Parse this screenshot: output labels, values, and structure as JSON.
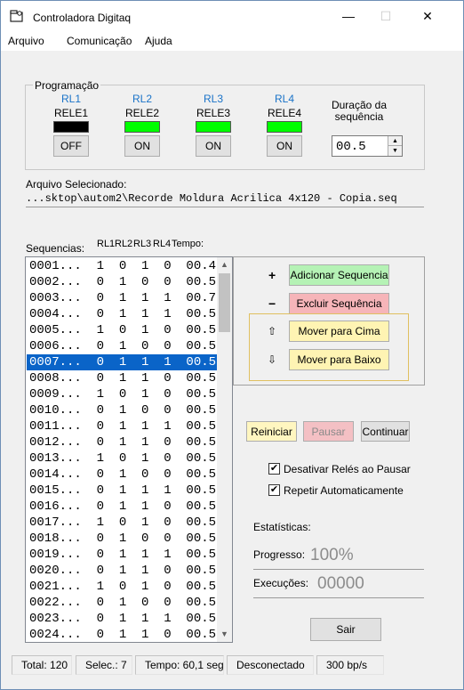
{
  "window": {
    "title": "Controladora Digitaq",
    "minimize": "—",
    "maximize": "☐",
    "close": "✕"
  },
  "menu": {
    "items": [
      "Arquivo",
      "Comunicação",
      "Ajuda"
    ]
  },
  "programacao": {
    "title": "Programação",
    "relays": [
      {
        "rl": "RL1",
        "name": "RELE1",
        "state": "off",
        "color": "#000000",
        "button": "OFF"
      },
      {
        "rl": "RL2",
        "name": "RELE2",
        "state": "on",
        "color": "#00ff00",
        "button": "ON"
      },
      {
        "rl": "RL3",
        "name": "RELE3",
        "state": "on",
        "color": "#00ff00",
        "button": "ON"
      },
      {
        "rl": "RL4",
        "name": "RELE4",
        "state": "on",
        "color": "#00ff00",
        "button": "ON"
      }
    ],
    "duracao_label_1": "Duração da",
    "duracao_label_2": "sequência",
    "duracao_value": "00.5"
  },
  "arquivo": {
    "label": "Arquivo Selecionado:",
    "path": "...sktop\\autom2\\Recorde Moldura Acrilica 4x120 - Copia.seq"
  },
  "sequencias": {
    "label": "Sequencias:",
    "headers": [
      "RL1",
      "RL2",
      "RL3",
      "RL4",
      "Tempo:"
    ],
    "selected_index": 6,
    "rows": [
      "0001...  1  0  1  0  00.4",
      "0002...  0  1  0  0  00.5",
      "0003...  0  1  1  1  00.7",
      "0004...  0  1  1  1  00.5",
      "0005...  1  0  1  0  00.5",
      "0006...  0  1  0  0  00.5",
      "0007...  0  1  1  1  00.5",
      "0008...  0  1  1  0  00.5",
      "0009...  1  0  1  0  00.5",
      "0010...  0  1  0  0  00.5",
      "0011...  0  1  1  1  00.5",
      "0012...  0  1  1  0  00.5",
      "0013...  1  0  1  0  00.5",
      "0014...  0  1  0  0  00.5",
      "0015...  0  1  1  1  00.5",
      "0016...  0  1  1  0  00.5",
      "0017...  1  0  1  0  00.5",
      "0018...  0  1  0  0  00.5",
      "0019...  0  1  1  1  00.5",
      "0020...  0  1  1  0  00.5",
      "0021...  1  0  1  0  00.5",
      "0022...  0  1  0  0  00.5",
      "0023...  0  1  1  1  00.5",
      "0024...  0  1  1  0  00.5"
    ]
  },
  "actions": {
    "adicionar": "Adicionar Sequencia",
    "excluir": "Excluir Sequência",
    "mover_cima": "Mover para Cima",
    "mover_baixo": "Mover para Baixo",
    "plus_sign": "+",
    "minus_sign": "−",
    "up_arrow": "⇧",
    "down_arrow": "⇩"
  },
  "controls": {
    "reiniciar": "Reiniciar",
    "pausar": "Pausar",
    "continuar": "Continuar",
    "desativar": "Desativar Relés ao Pausar",
    "repetir": "Repetir Automaticamente",
    "desativar_checked": true,
    "repetir_checked": true
  },
  "stats": {
    "title": "Estatísticas:",
    "progresso_label": "Progresso:",
    "progresso_value": "100%",
    "execucoes_label": "Execuções:",
    "execucoes_value": "00000"
  },
  "sair": "Sair",
  "status": {
    "total": "Total: 120",
    "selec": "Selec.: 7",
    "tempo": "Tempo: 60,1 seg",
    "conexao": "Desconectado",
    "baud": "300 bp/s"
  },
  "colors": {
    "add_green": "#b5f2b5",
    "del_red": "#f6b5b9",
    "move_yellow": "#fff4b3",
    "reiniciar_yellow": "#fff6c0",
    "pausar_pink": "#f4c0c4",
    "selection_blue": "#0a64c8",
    "rl_blue": "#1a73c8"
  }
}
